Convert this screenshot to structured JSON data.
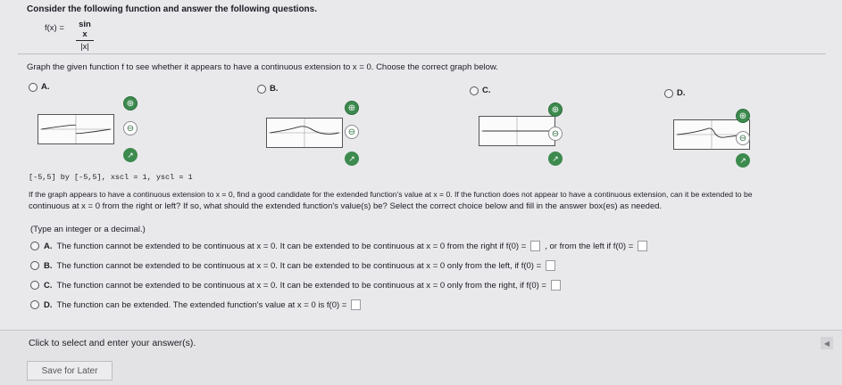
{
  "header": {
    "instructions": "Consider the following function and answer the following questions."
  },
  "function": {
    "lhs": "f(x) =",
    "numerator": "sin x",
    "denominator": "|x|"
  },
  "part1": {
    "question": "Graph the given function f to see whether it appears to have a continuous extension to x = 0. Choose the correct graph below."
  },
  "graph_options": [
    {
      "label": "A."
    },
    {
      "label": "B."
    },
    {
      "label": "C."
    },
    {
      "label": "D."
    }
  ],
  "window_caption": "[-5,5] by [-5,5], xscl = 1, yscl = 1",
  "part2": {
    "question_line1": "If the graph appears to have a continuous extension to x = 0, find a good candidate for the extended function's value at x = 0. If the function does not appear to have a continuous extension, can it be extended to be",
    "question_line2": "continuous at x = 0 from the right or left? If so, what should the extended function's value(s) be? Select the correct choice below and fill in the answer box(es) as needed.",
    "hint": "(Type an integer or a decimal.)"
  },
  "choices": [
    {
      "letter": "A.",
      "text": "The function cannot be extended to be continuous at x = 0. It can be extended to be continuous at x = 0 from the right if f(0) =",
      "text2": ", or from the left if f(0) ="
    },
    {
      "letter": "B.",
      "text": "The function cannot be extended to be continuous at x = 0. It can be extended to be continuous at x = 0 only from the left, if f(0) ="
    },
    {
      "letter": "C.",
      "text": "The function cannot be extended to be continuous at x = 0. It can be extended to be continuous at x = 0 only from the right, if f(0) ="
    },
    {
      "letter": "D.",
      "text": "The function can be extended. The extended function's value at x = 0 is f(0) ="
    }
  ],
  "footer": {
    "prompt": "Click to select and enter your answer(s).",
    "save_label": "Save for Later"
  }
}
